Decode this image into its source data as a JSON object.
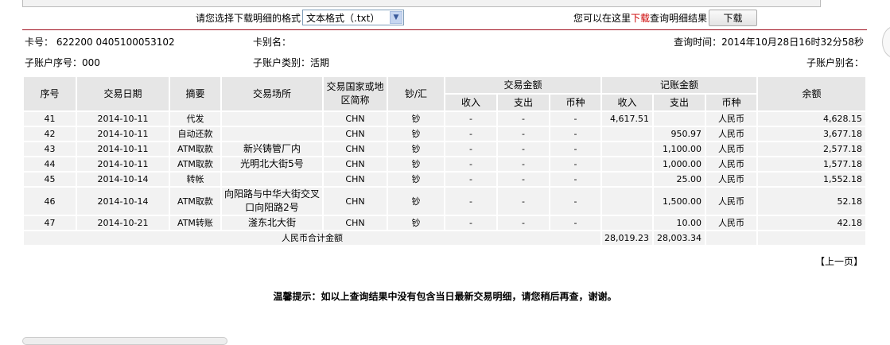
{
  "toolbar": {
    "format_label": "请您选择下载明细的格式",
    "format_value": "文本格式（.txt）",
    "download_prefix": "您可以在这里",
    "download_link": "下载",
    "download_suffix": "查询明细结果",
    "download_button": "下载"
  },
  "info": {
    "card_no": "卡号： 622200 0405100053102",
    "card_alias": "卡别名：",
    "query_time": "查询时间：2014年10月28日16时32分58秒",
    "sub_no": "子账户序号：000",
    "sub_type": "子账户类别：活期",
    "sub_alias": "子账户别名："
  },
  "table": {
    "headers": {
      "no": "序号",
      "date": "交易日期",
      "summary": "摘要",
      "place": "交易场所",
      "country": "交易国家或地区简称",
      "cash": "钞/汇",
      "trade_amount": "交易金额",
      "book_amount": "记账金额",
      "balance": "余额",
      "income": "收入",
      "expense": "支出",
      "currency": "币种"
    },
    "rows": [
      [
        "41",
        "2014-10-11",
        "代发",
        "",
        "CHN",
        "钞",
        "-",
        "-",
        "-",
        "4,617.51",
        "",
        "人民币",
        "4,628.15"
      ],
      [
        "42",
        "2014-10-11",
        "自动还款",
        "",
        "CHN",
        "钞",
        "-",
        "-",
        "-",
        "",
        "950.97",
        "人民币",
        "3,677.18"
      ],
      [
        "43",
        "2014-10-11",
        "ATM取款",
        "新兴铸管厂内",
        "CHN",
        "钞",
        "-",
        "-",
        "-",
        "",
        "1,100.00",
        "人民币",
        "2,577.18"
      ],
      [
        "44",
        "2014-10-11",
        "ATM取款",
        "光明北大街5号",
        "CHN",
        "钞",
        "-",
        "-",
        "-",
        "",
        "1,000.00",
        "人民币",
        "1,577.18"
      ],
      [
        "45",
        "2014-10-14",
        "转帐",
        "",
        "CHN",
        "钞",
        "-",
        "-",
        "-",
        "",
        "25.00",
        "人民币",
        "1,552.18"
      ],
      [
        "46",
        "2014-10-14",
        "ATM取款",
        "向阳路与中华大街交叉口向阳路2号",
        "CHN",
        "钞",
        "-",
        "-",
        "-",
        "",
        "1,500.00",
        "人民币",
        "52.18"
      ],
      [
        "47",
        "2014-10-21",
        "ATM转账",
        "滏东北大街",
        "CHN",
        "钞",
        "-",
        "-",
        "-",
        "",
        "10.00",
        "人民币",
        "42.18"
      ]
    ],
    "total_label": "人民币合计金额",
    "total_income": "28,019.23",
    "total_expense": "28,003.34"
  },
  "pager": {
    "prev": "【上一页】"
  },
  "notice": "温馨提示：如以上查询结果中没有包含当日最新交易明细，请您稍后再查，谢谢。"
}
